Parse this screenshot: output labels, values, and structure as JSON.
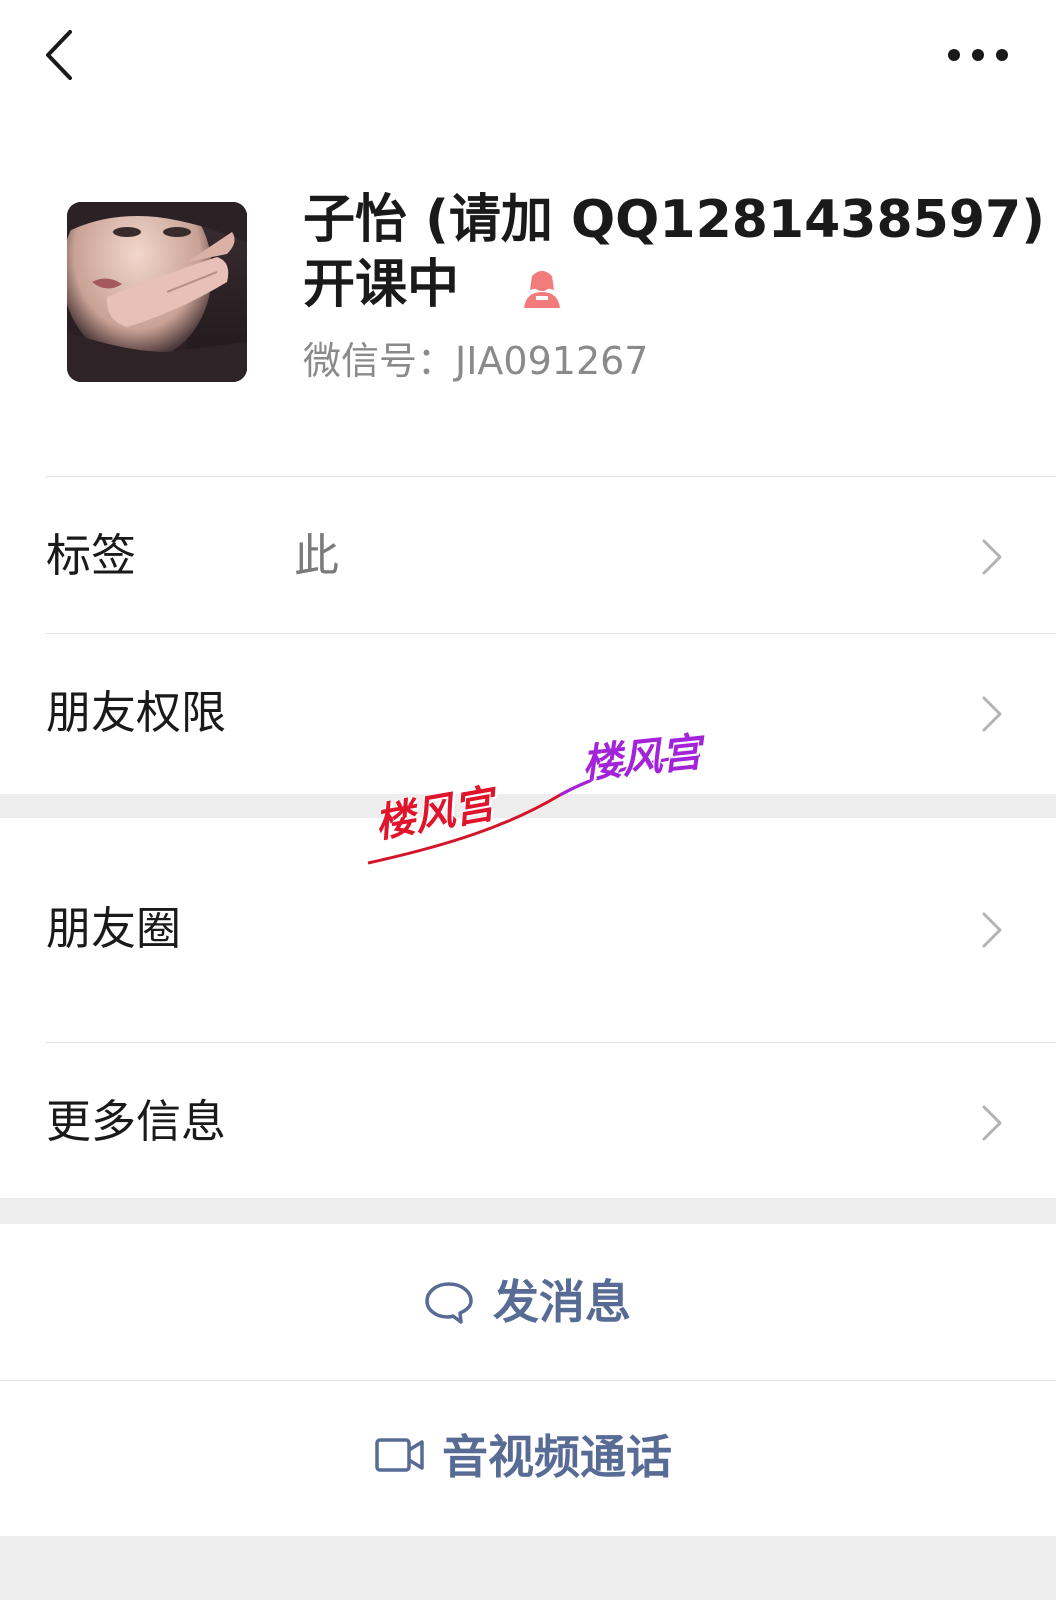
{
  "header": {
    "back_icon": "back-chevron-icon",
    "more_icon": "more-dots-icon"
  },
  "profile": {
    "name_line1": "子怡 (请加 QQ1281438597)",
    "name_line2": "开课中",
    "gender_icon": "female-user-icon",
    "gender_color": "#f27c7c",
    "wechat_id": "微信号：JIA091267"
  },
  "rows": {
    "tags_label": "标签",
    "tags_value": "此",
    "permission_label": "朋友权限",
    "moments_label": "朋友圈",
    "more_info_label": "更多信息"
  },
  "actions": {
    "send_message_label": "发消息",
    "send_message_icon": "chat-bubble-icon",
    "call_label": "音视频通话",
    "call_icon": "video-camera-icon",
    "accent_color": "#576b95"
  },
  "watermark": {
    "text1": "楼风宫",
    "text2": "楼风宫"
  }
}
